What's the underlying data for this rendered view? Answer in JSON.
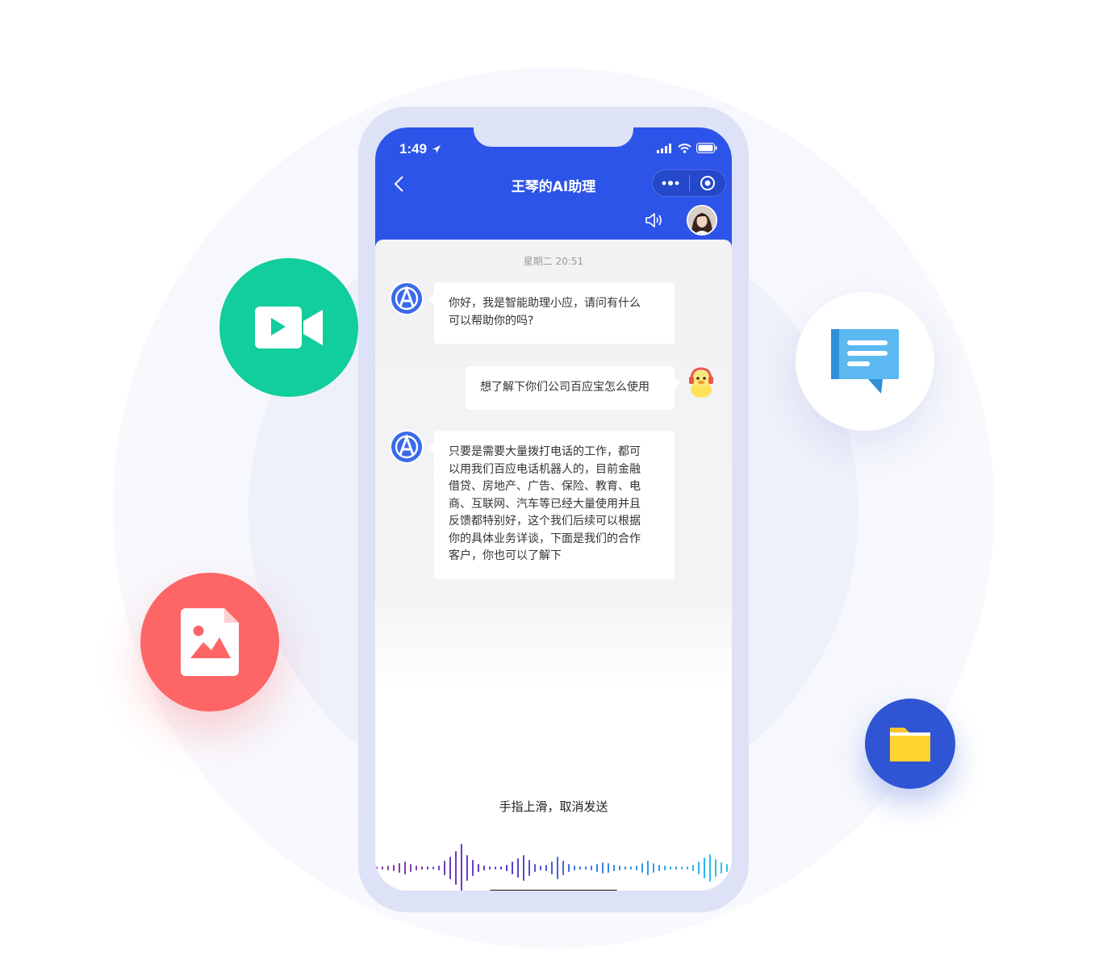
{
  "status_bar": {
    "time": "1:49"
  },
  "nav": {
    "title": "王琴的AI助理",
    "back_icon": "chevron-left-icon",
    "more_icon": "more-dots-icon",
    "close_icon": "target-circle-icon"
  },
  "chat": {
    "timestamp": "星期二 20:51",
    "messages": [
      {
        "sender": "bot",
        "lines": [
          "你好，我是智能助理小应，请问有什么",
          "可以帮助你的吗?"
        ]
      },
      {
        "sender": "user",
        "lines": [
          "想了解下你们公司百应宝怎么使用"
        ]
      },
      {
        "sender": "bot",
        "lines": [
          "只要是需要大量拨打电话的工作，都可",
          "以用我们百应电话机器人的，目前金融",
          "借贷、房地产、广告、保险、教育、电",
          "商、互联网、汽车等已经大量使用并且",
          "反馈都特别好，这个我们后续可以根据",
          "你的具体业务详谈，下面是我们的合作",
          "客户，你也可以了解下"
        ]
      }
    ]
  },
  "voice": {
    "hint": "手指上滑，取消发送",
    "mic_icon": "microphone-icon"
  },
  "decorations": {
    "video_icon": "video-camera-icon",
    "image_icon": "image-file-icon",
    "message_icon": "chat-message-icon",
    "folder_icon": "folder-icon"
  },
  "colors": {
    "header_blue": "#2d54e8",
    "video_green": "#12cd9c",
    "image_red": "#fd6566",
    "folder_blue": "#2f55d4",
    "mic_blue": "#2f7cf6"
  }
}
